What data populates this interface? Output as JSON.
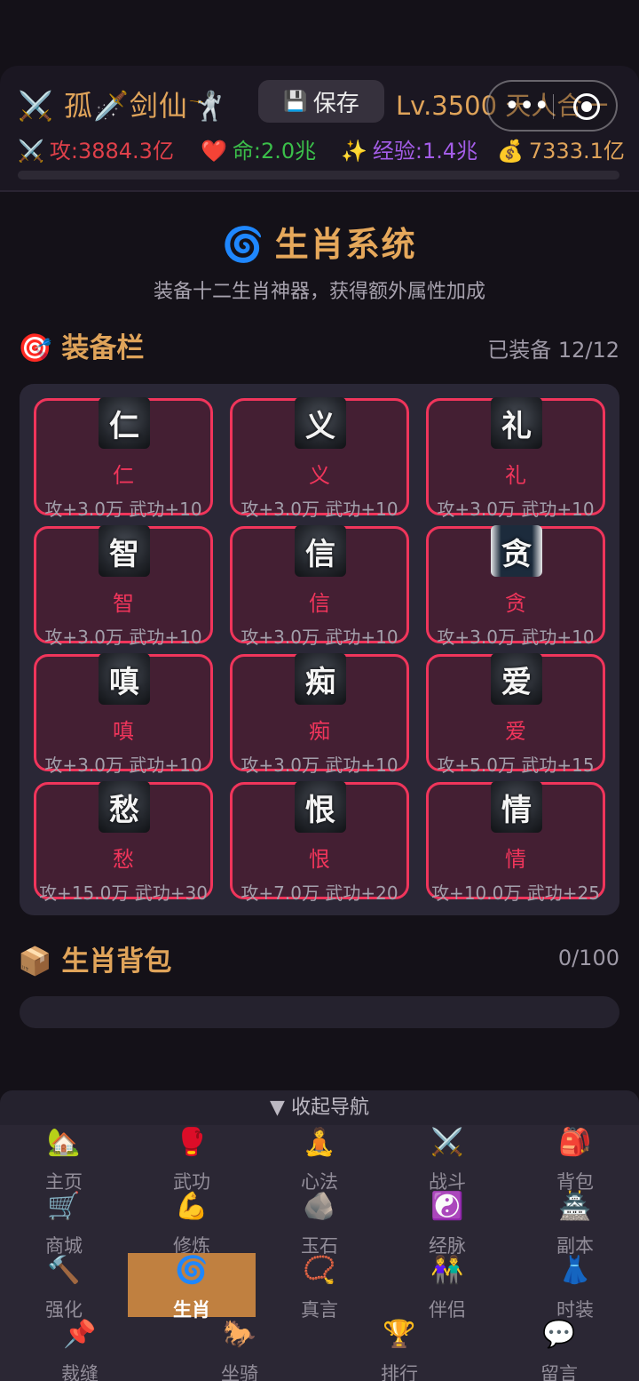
{
  "header": {
    "player_name": "⚔️ 孤🗡️剑仙🤺",
    "save_label": "保存",
    "level": "Lv.3500 天人合一",
    "stats": {
      "attack": "攻:3884.3亿",
      "life": "命:2.0兆",
      "exp": "经验:1.4兆",
      "money": "7333.1亿"
    },
    "colors": {
      "attack": "#e0404a",
      "life": "#3bbf4a",
      "exp": "#a45de8",
      "money": "#e0a45a"
    }
  },
  "zodiac": {
    "title": "生肖系统",
    "subtitle": "装备十二生肖神器，获得额外属性加成",
    "equip_title": "装备栏",
    "equip_count": "已装备 12/12",
    "slots": [
      {
        "glyph": "仁",
        "name": "仁",
        "stats": "攻+3.0万 武功+10"
      },
      {
        "glyph": "义",
        "name": "义",
        "stats": "攻+3.0万 武功+10"
      },
      {
        "glyph": "礼",
        "name": "礼",
        "stats": "攻+3.0万 武功+10"
      },
      {
        "glyph": "智",
        "name": "智",
        "stats": "攻+3.0万 武功+10"
      },
      {
        "glyph": "信",
        "name": "信",
        "stats": "攻+3.0万 武功+10"
      },
      {
        "glyph": "贪",
        "name": "贪",
        "stats": "攻+3.0万 武功+10"
      },
      {
        "glyph": "嗔",
        "name": "嗔",
        "stats": "攻+3.0万 武功+10"
      },
      {
        "glyph": "痴",
        "name": "痴",
        "stats": "攻+3.0万 武功+10"
      },
      {
        "glyph": "爱",
        "name": "爱",
        "stats": "攻+5.0万 武功+15"
      },
      {
        "glyph": "愁",
        "name": "愁",
        "stats": "攻+15.0万 武功+30"
      },
      {
        "glyph": "恨",
        "name": "恨",
        "stats": "攻+7.0万 武功+20"
      },
      {
        "glyph": "情",
        "name": "情",
        "stats": "攻+10.0万 武功+25"
      }
    ],
    "bag_title": "生肖背包",
    "bag_count": "0/100"
  },
  "nav": {
    "toggle_label": "▼ 收起导航",
    "rows": [
      [
        {
          "icon": "🏡",
          "label": "主页"
        },
        {
          "icon": "🥊",
          "label": "武功"
        },
        {
          "icon": "🧘",
          "label": "心法"
        },
        {
          "icon": "⚔️",
          "label": "战斗"
        },
        {
          "icon": "🎒",
          "label": "背包"
        }
      ],
      [
        {
          "icon": "🛒",
          "label": "商城"
        },
        {
          "icon": "💪",
          "label": "修炼"
        },
        {
          "icon": "🪨",
          "label": "玉石"
        },
        {
          "icon": "☯️",
          "label": "经脉"
        },
        {
          "icon": "🏯",
          "label": "副本"
        }
      ],
      [
        {
          "icon": "🔨",
          "label": "强化"
        },
        {
          "icon": "🌀",
          "label": "生肖",
          "active": true
        },
        {
          "icon": "📿",
          "label": "真言"
        },
        {
          "icon": "👫",
          "label": "伴侣"
        },
        {
          "icon": "👗",
          "label": "时装"
        }
      ],
      [
        {
          "icon": "📌",
          "label": "裁缝"
        },
        {
          "icon": "🐎",
          "label": "坐骑"
        },
        {
          "icon": "🏆",
          "label": "排行"
        },
        {
          "icon": "💬",
          "label": "留言"
        }
      ]
    ],
    "active_color": "#c08040"
  }
}
